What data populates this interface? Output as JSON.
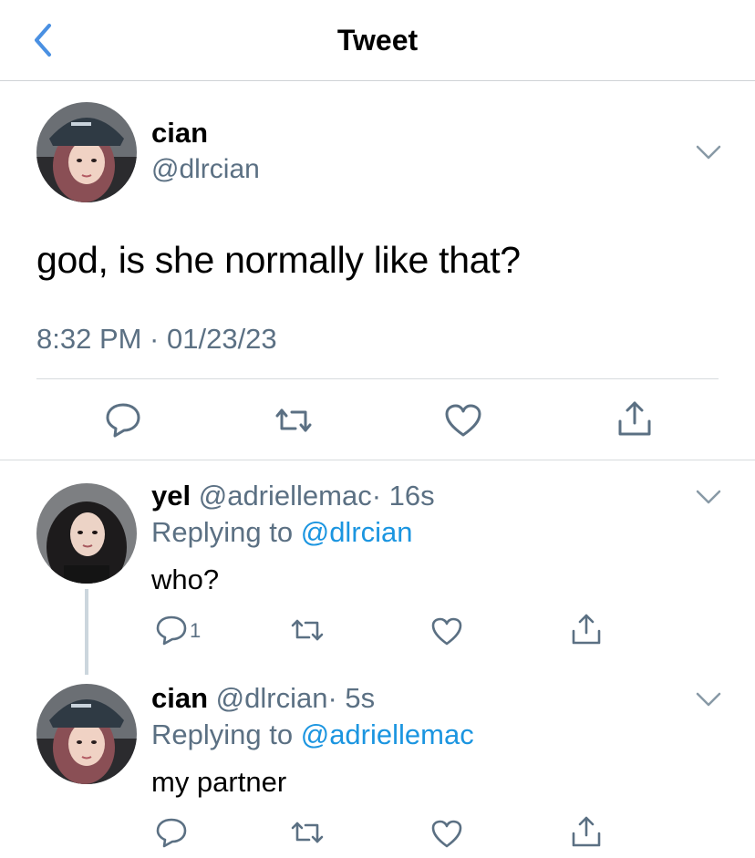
{
  "header": {
    "title": "Tweet",
    "back_icon": "chevron-left-icon",
    "accent": "#4a90e2"
  },
  "main_tweet": {
    "name": "cian",
    "handle": "@dlrcian",
    "text": "god, is she normally like that?",
    "timestamp": "8:32 PM · 01/23/23",
    "actions": [
      "reply-icon",
      "retweet-icon",
      "like-icon",
      "share-icon"
    ]
  },
  "replies": [
    {
      "name": "yel",
      "handle": "@adriellemac",
      "time": "· 16s",
      "replying_prefix": "Replying to ",
      "replying_to": "@dlrcian",
      "text": "who?",
      "reply_count": "1"
    },
    {
      "name": "cian",
      "handle": "@dlrcian",
      "time": "· 5s",
      "replying_prefix": "Replying to ",
      "replying_to": "@adriellemac",
      "text": "my partner",
      "reply_count": ""
    }
  ],
  "colors": {
    "secondary_text": "#5b7083",
    "link": "#1b95e0",
    "divider": "#d6dadd"
  }
}
